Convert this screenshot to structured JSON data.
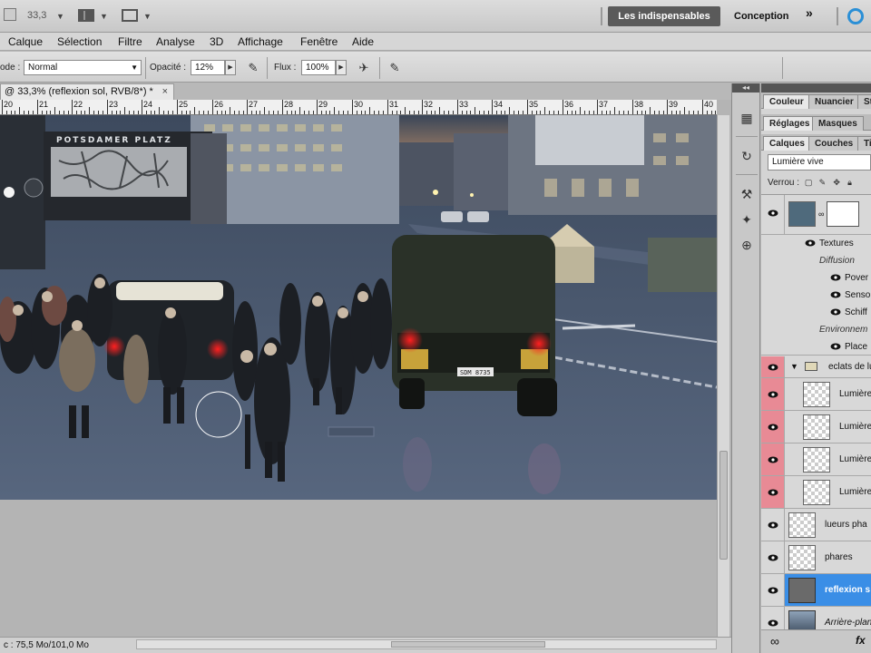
{
  "app_bar": {
    "zoom_value": "33,3",
    "workspace_active": "Les indispensables",
    "workspace_other": "Conception",
    "more_glyph": "»"
  },
  "menu": [
    "Calque",
    "Sélection",
    "Filtre",
    "Analyse",
    "3D",
    "Affichage",
    "Fenêtre",
    "Aide"
  ],
  "options_bar": {
    "mode_label": "ode :",
    "mode_value": "Normal",
    "opacity_label": "Opacité :",
    "opacity_value": "12%",
    "flow_label": "Flux :",
    "flow_value": "100%"
  },
  "document_tab": {
    "title": "@ 33,3% (reflexion sol, RVB/8*) *",
    "close": "×"
  },
  "ruler": {
    "numbers": [
      "20",
      "21",
      "22",
      "23",
      "24",
      "25",
      "26",
      "27",
      "28",
      "29",
      "30",
      "31",
      "32",
      "33",
      "34",
      "35",
      "36",
      "37",
      "38",
      "39",
      "40"
    ]
  },
  "image": {
    "sign_text": "POTSDAMER PLATZ",
    "plate_text": "SDM 8735"
  },
  "status_bar": {
    "doc_info": "c : 75,5 Mo/101,0 Mo"
  },
  "panels": {
    "tab_row1": [
      "Couleur",
      "Nuancier",
      "St"
    ],
    "tab_row2": [
      "Réglages",
      "Masques"
    ],
    "tab_row3": [
      "Calques",
      "Couches",
      "Ti"
    ],
    "blend_mode": "Lumière vive",
    "lock_label": "Verrou :"
  },
  "layers": {
    "effects_header": "Textures",
    "diffusion_label": "Diffusion",
    "diffusion_items": [
      "Pover",
      "Sensor",
      "Schiff"
    ],
    "environment_label": "Environnem",
    "environment_items": [
      "Place"
    ],
    "group_name": "eclats de lu",
    "group_children": [
      "Lumière",
      "Lumière",
      "Lumière",
      "Lumière"
    ],
    "layer_lueurs": "lueurs pha",
    "layer_phares": "phares",
    "layer_reflexion": "reflexion s",
    "layer_background": "Arrière-plan"
  },
  "colors": {
    "selected_layer": "#3a8ee6",
    "visibility_highlight": "#e88a95",
    "workspace_active_bg": "#5a5a5a",
    "adobe_icon": "#2a8fd6"
  },
  "icons": [
    "launch-bridge-icon",
    "arrange-icon",
    "screen-mode-icon",
    "airbrush-icon",
    "tablet-pressure-icon",
    "eye-icon",
    "folder-icon",
    "chain-link-icon",
    "fx-icon"
  ]
}
